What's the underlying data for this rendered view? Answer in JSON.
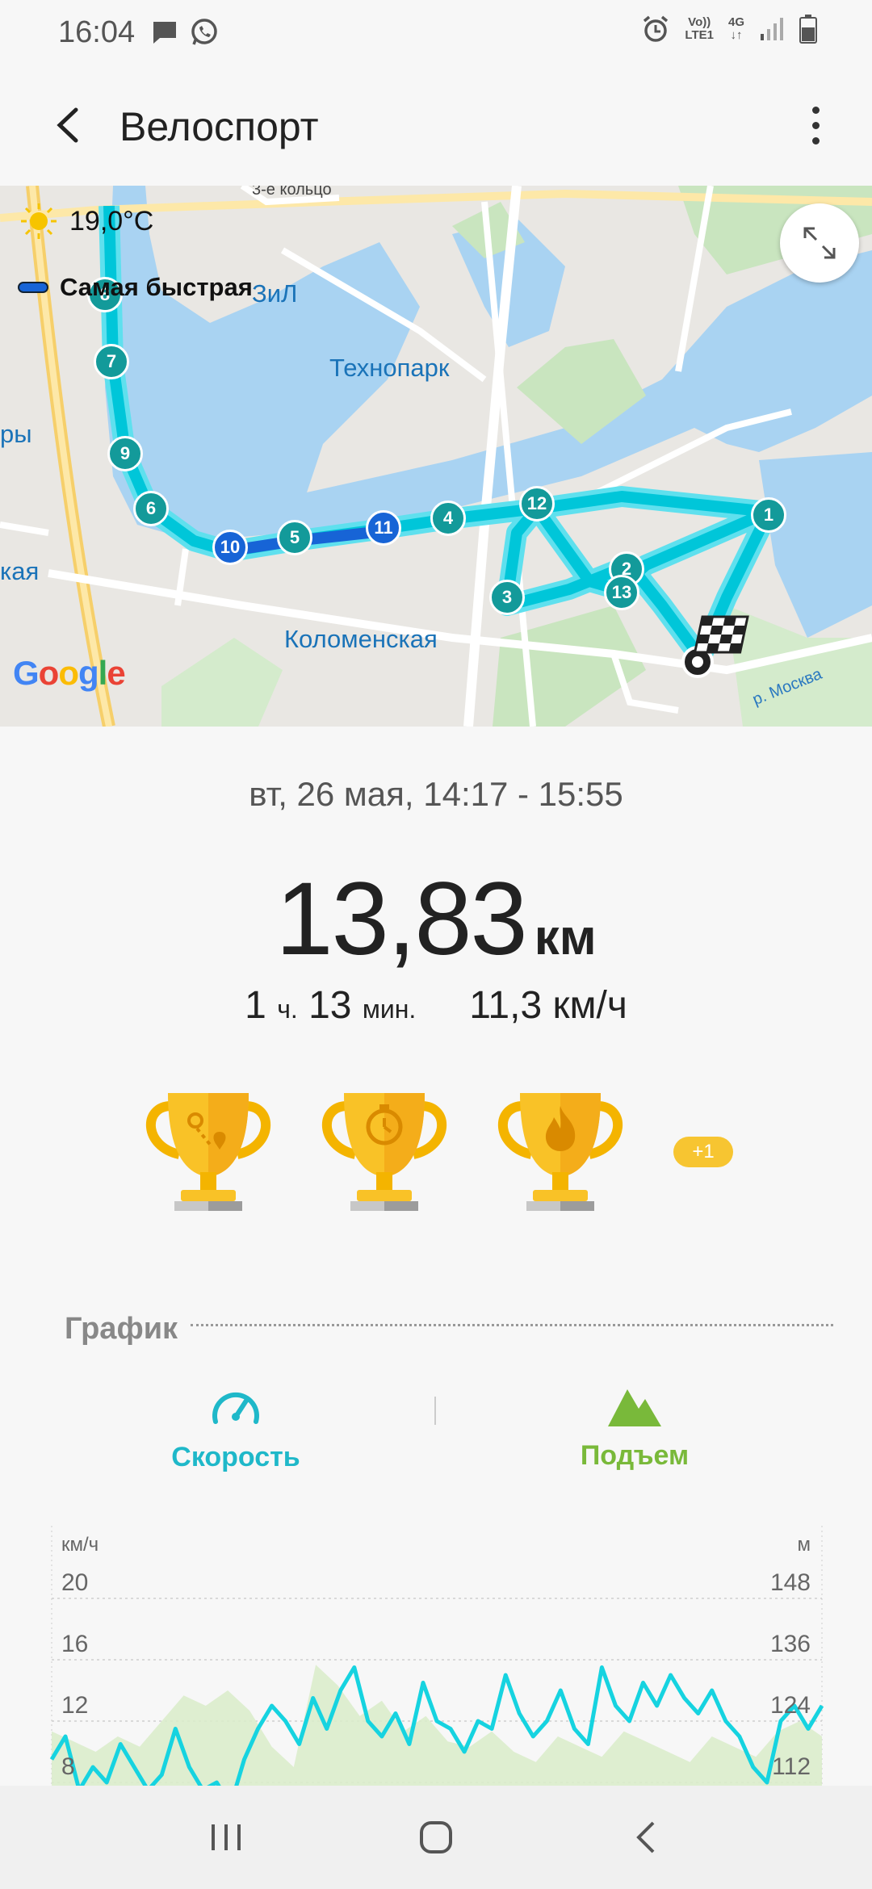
{
  "status_bar": {
    "time": "16:04",
    "network_top": "Vo))",
    "network_bottom": "LTE1",
    "network_gen": "4G",
    "icons": [
      "message-icon",
      "whatsapp-icon",
      "alarm-icon",
      "signal-icon",
      "battery-icon"
    ]
  },
  "appbar": {
    "title": "Велоспорт"
  },
  "map": {
    "weather": "19,0°C",
    "legend_label": "Самая быстрая",
    "places": {
      "ring": "3-е кольцо",
      "zil": "ЗиЛ",
      "technopark": "Технопарк",
      "kolomenskaya": "Коломенская",
      "kaya": "кая",
      "ry": "ры",
      "river": "р. Москва"
    },
    "google": [
      "G",
      "o",
      "o",
      "g",
      "l",
      "e"
    ],
    "route_markers": [
      "1",
      "2",
      "3",
      "4",
      "5",
      "6",
      "7",
      "8",
      "9",
      "10",
      "11",
      "12",
      "13"
    ]
  },
  "summary": {
    "date": "вт, 26 мая, 14:17 - 15:55",
    "distance_value": "13,83",
    "distance_unit": "км",
    "duration_h": "1",
    "duration_h_unit": "ч.",
    "duration_m": "13",
    "duration_m_unit": "мин.",
    "speed": "11,3 км/ч"
  },
  "trophies": {
    "items": [
      "distance-trophy",
      "time-trophy",
      "calories-trophy"
    ],
    "more": "+1"
  },
  "graph": {
    "title": "График",
    "tab_speed": "Скорость",
    "tab_climb": "Подъем",
    "left_unit": "км/ч",
    "right_unit": "м",
    "left_ticks": [
      "20",
      "16",
      "12",
      "8"
    ],
    "right_ticks": [
      "148",
      "136",
      "124",
      "112"
    ]
  },
  "chart_data": {
    "type": "line",
    "ylabel": "км/ч",
    "ylabel_right": "м",
    "ylim": [
      8,
      20
    ],
    "ylim_right": [
      112,
      148
    ],
    "series": [
      {
        "values": [
          9.5,
          11,
          7.5,
          9,
          8,
          10.5,
          9,
          7.5,
          8.5,
          11.5,
          9,
          7.5,
          8,
          6.5,
          9.5,
          11.5,
          13,
          12,
          10.5,
          13.5,
          11.5,
          14,
          15.5,
          12,
          11,
          12.5,
          10.5,
          14.5,
          12,
          11.5,
          10,
          12,
          11.5,
          15,
          12.5,
          11,
          12,
          14,
          11.5,
          10.5,
          15.5,
          13,
          12,
          14.5,
          13,
          15,
          13.5,
          12.5,
          14,
          12,
          11,
          9,
          8,
          12,
          13,
          11.5,
          13
        ]
      },
      {
        "type": "area",
        "values": [
          122,
          120,
          118,
          121,
          119,
          124,
          129,
          127,
          130,
          126,
          119,
          115,
          135,
          131,
          125,
          128,
          122,
          125,
          120,
          119,
          122,
          118,
          116,
          121,
          119,
          117,
          122,
          120,
          118,
          116,
          121,
          119,
          117,
          122,
          124,
          121
        ]
      }
    ]
  }
}
